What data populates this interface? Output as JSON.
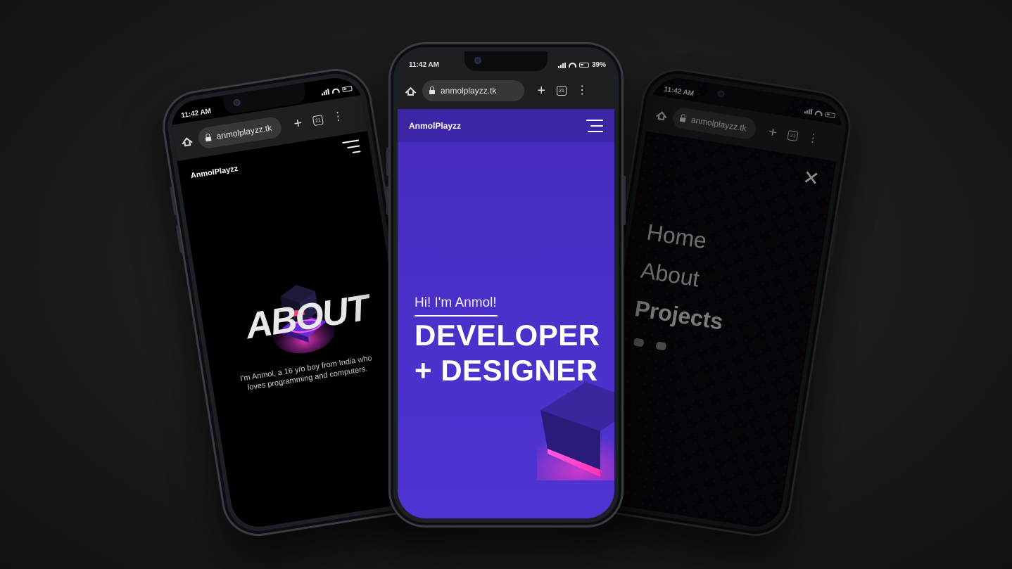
{
  "status_bar": {
    "time": "11:42 AM",
    "battery": "39%"
  },
  "browser": {
    "url": "anmolplayzz.tk",
    "tab_count": "21"
  },
  "site": {
    "brand": "AnmolPlayzz"
  },
  "center_screen": {
    "greeting": "Hi! I'm Anmol!",
    "headline_line1": "DEVELOPER",
    "headline_line2": "+ DESIGNER"
  },
  "left_screen": {
    "section_title": "ABOUT",
    "bio": "I'm Anmol, a 16 y/o boy from India who loves programming and computers."
  },
  "right_screen": {
    "menu_items": [
      "Home",
      "About",
      "Projects"
    ],
    "active_item": "Projects",
    "social_icons": [
      "discord-icon",
      "twitter-icon"
    ]
  },
  "colors": {
    "hero_purple": "#4a2fc6",
    "header_purple": "#3d26a5",
    "neon_pink": "#ff3cc8",
    "background": "#1d1d1d"
  }
}
